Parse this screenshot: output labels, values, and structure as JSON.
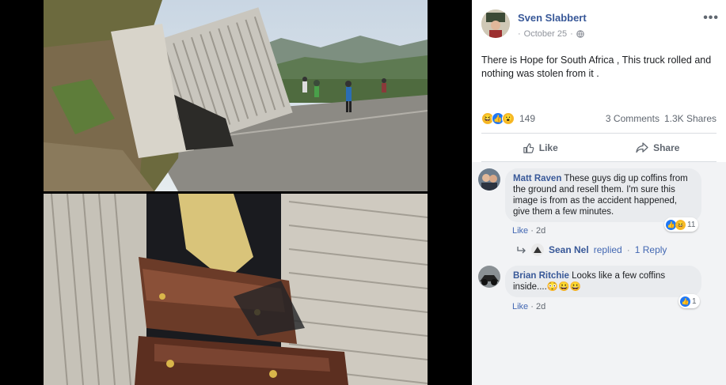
{
  "post": {
    "author": "Sven Slabbert",
    "date": "October 25",
    "privacy_icon": "globe-icon",
    "more_icon": "more-options-icon",
    "text": "There is Hope for South Africa , This truck rolled and nothing was stolen from it .",
    "reactions": {
      "icons": [
        "haha",
        "like",
        "wow"
      ],
      "count": "149"
    },
    "comments_count": "3 Comments",
    "shares_count": "1.3K Shares",
    "actions": {
      "like_label": "Like",
      "share_label": "Share"
    }
  },
  "comments": [
    {
      "name": "Matt Raven",
      "text": "These guys dig up coffins from the ground and resell them. I'm sure this image is from as the accident happened, give them a few minutes.",
      "like_label": "Like",
      "time": "2d",
      "reaction_count": "11",
      "reply": {
        "name": "Sean Nel",
        "replied": "replied",
        "dot": "·",
        "reply_count_label": "1 Reply"
      }
    },
    {
      "name": "Brian Ritchie",
      "text": "Looks like a few coffins inside....",
      "emojis": "😳😀😀",
      "like_label": "Like",
      "time": "2d",
      "reaction_count": "1"
    }
  ],
  "colors": {
    "link_blue": "#385898",
    "like_blue": "#2078f4",
    "haha_yellow": "#f7b928",
    "comment_bg": "#e9ebee",
    "comment_area_bg": "#f2f3f5"
  }
}
